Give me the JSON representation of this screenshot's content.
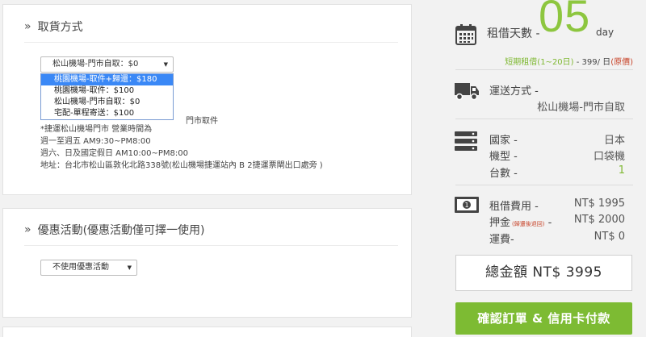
{
  "pickup": {
    "title": "取貨方式",
    "select_value": "松山機場-門市自取：$0",
    "options": [
      "桃園機場-取件+歸還：$180",
      "桃園機場-取件：$100",
      "松山機場-門市自取：$0",
      "宅配-單程寄送：$100"
    ],
    "info_partial_right": "門市取件",
    "info": [
      "*捷運松山機場門市 營業時間為",
      "週一至週五 AM9:30~PM8:00",
      "週六、日及國定假日 AM10:00~PM8:00",
      "地址：台北市松山區敦化北路338號(松山機場捷運站內 B 2捷運票閘出口處旁 )"
    ]
  },
  "promo": {
    "title": "優惠活動(優惠活動僅可擇一使用)",
    "select_value": "不使用優惠活動"
  },
  "summary": {
    "days_label": "租借天數 -",
    "days_value": "05",
    "days_unit": "day",
    "rate_note_green": "短期租借(1~20日)",
    "rate_note_dark": " - 399/ 日",
    "rate_note_red": "(原價)",
    "shipping_label": "運送方式 -",
    "shipping_value": "松山機場-門市自取",
    "country_label": "國家 -",
    "country_value": "日本",
    "model_label": "機型 -",
    "model_value": "口袋機",
    "units_label": "台數 -",
    "units_value": "1",
    "fee_label": "租借費用 -",
    "fee_value": "NT$ 1995",
    "deposit_label": "押金",
    "deposit_note": "(歸還後退回)",
    "deposit_sep": " -",
    "deposit_value": "NT$ 2000",
    "freight_label": "運費-",
    "freight_value": "NT$ 0",
    "total": "總金額 NT$ 3995",
    "confirm_button": "確認訂單 & 信用卡付款"
  },
  "colors": {
    "accent_green": "#7dbb33",
    "days_green": "#8dc63f",
    "dropdown_highlight": "#3a88f6",
    "note_red": "#c8452b"
  }
}
